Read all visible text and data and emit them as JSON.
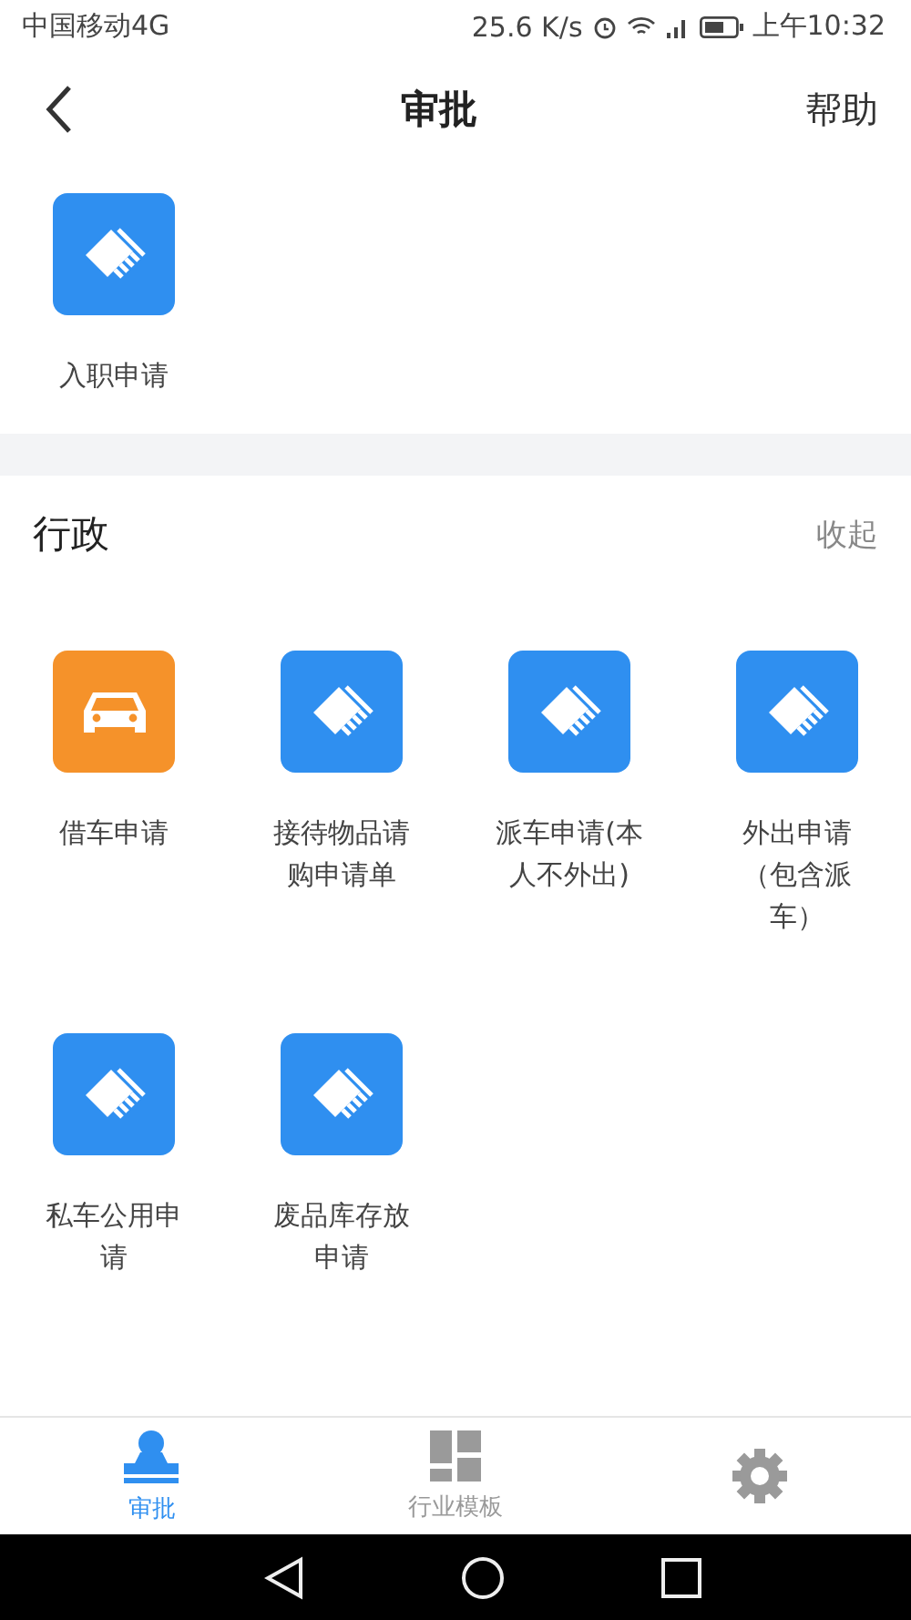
{
  "status_bar": {
    "carrier": "中国移动4G",
    "speed": "25.6 K/s",
    "time": "上午10:32"
  },
  "header": {
    "title": "审批",
    "action": "帮助"
  },
  "sections": [
    {
      "items": [
        {
          "label": "入职申请",
          "kind": "form"
        }
      ]
    },
    {
      "title": "行政",
      "collapse": "收起",
      "items": [
        {
          "label": "借车申请",
          "kind": "car"
        },
        {
          "label": "接待物品请购申请单",
          "kind": "form"
        },
        {
          "label": "派车申请(本人不外出)",
          "kind": "form"
        },
        {
          "label": "外出申请（包含派车）",
          "kind": "form"
        },
        {
          "label": "私车公用申请",
          "kind": "form"
        },
        {
          "label": "废品库存放申请",
          "kind": "form"
        }
      ]
    }
  ],
  "tabs": [
    {
      "label": "审批",
      "kind": "stamp",
      "selected": true
    },
    {
      "label": "行业模板",
      "kind": "grid",
      "selected": false
    },
    {
      "kind": "gear",
      "selected": false
    }
  ]
}
